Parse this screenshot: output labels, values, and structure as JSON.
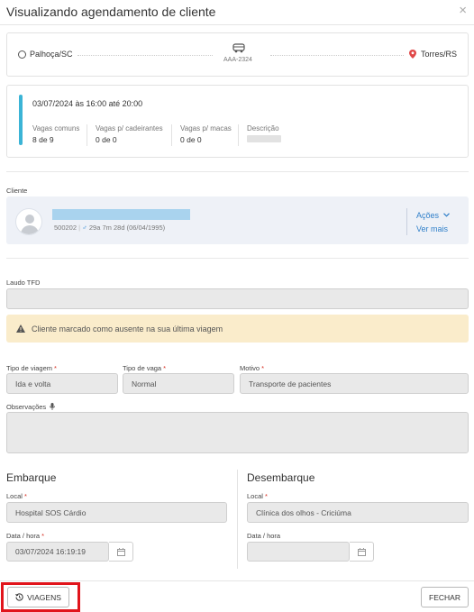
{
  "modal": {
    "title": "Visualizando agendamento de cliente",
    "close_symbol": "×"
  },
  "route": {
    "origin": "Palhoça/SC",
    "plate": "AAA-2324",
    "destination": "Torres/RS"
  },
  "schedule": {
    "when": "03/07/2024 às 16:00 até 20:00",
    "stats": [
      {
        "label": "Vagas comuns",
        "value": "8 de 9"
      },
      {
        "label": "Vagas p/ cadeirantes",
        "value": "0 de 0"
      },
      {
        "label": "Vagas p/ macas",
        "value": "0 de 0"
      },
      {
        "label": "Descrição",
        "value": ""
      }
    ]
  },
  "client": {
    "section_label": "Cliente",
    "id": "500202",
    "separator": "|",
    "gender_symbol": "♂",
    "age": "29a 7m 28d (06/04/1995)",
    "actions_label": "Ações",
    "more_label": "Ver mais"
  },
  "laudo": {
    "label": "Laudo TFD",
    "value": ""
  },
  "alert": {
    "text": "Cliente marcado como ausente na sua última viagem",
    "color": "#faeccb"
  },
  "trip": {
    "tipo_viagem": {
      "label": "Tipo de viagem",
      "value": "Ida e volta"
    },
    "tipo_vaga": {
      "label": "Tipo de vaga",
      "value": "Normal"
    },
    "motivo": {
      "label": "Motivo",
      "value": "Transporte de pacientes"
    },
    "observacoes": {
      "label": "Observações",
      "value": ""
    }
  },
  "embarque": {
    "title": "Embarque",
    "local_label": "Local",
    "local_value": "Hospital SOS Cárdio",
    "datetime_label": "Data / hora",
    "datetime_value": "03/07/2024 16:19:19"
  },
  "desembarque": {
    "title": "Desembarque",
    "local_label": "Local",
    "local_value": "Clínica dos olhos - Criciúma",
    "datetime_label": "Data / hora",
    "datetime_value": ""
  },
  "footer": {
    "viagens_label": "VIAGENS",
    "fechar_label": "FECHAR"
  },
  "colors": {
    "accent": "#3bb4d6",
    "link": "#2f7fc9",
    "required": "#d62d20",
    "highlight": "#e1141b"
  }
}
